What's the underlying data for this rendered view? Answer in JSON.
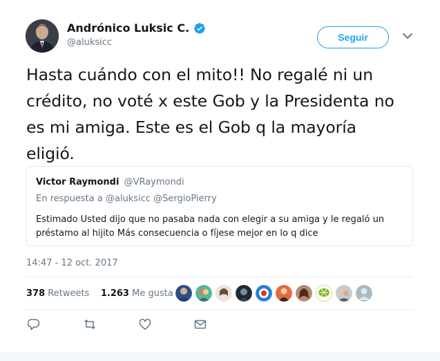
{
  "author": {
    "name": "Andrónico Luksic C.",
    "handle": "@aluksicc",
    "verified": true
  },
  "follow_label": "Seguir",
  "tweet_lines": [
    "Hasta cuándo con el mito!! No regalé ni un",
    "crédito, no voté x este Gob y la Presidenta no",
    "es mi amiga. Este es el Gob q la mayoría",
    "eligió."
  ],
  "quoted": {
    "name": "Victor Raymondi",
    "handle": "@VRaymondi",
    "reply_prefix": "En respuesta a",
    "reply_handles": "@aluksicc @SergioPierry",
    "text_lines": [
      "Estimado Usted dijo que no pasaba nada con elegir a su amiga y le regaló un",
      "préstamo al hijito Más consecuencia o fíjese mejor en lo q dice"
    ]
  },
  "timestamp": "14:47 - 12 oct. 2017",
  "stats": {
    "retweets_count": "378",
    "retweets_label": "Retweets",
    "likes_count": "1.263",
    "likes_label": "Me gusta"
  },
  "colors": {
    "accent": "#1da1f2",
    "secondary_text": "#657786",
    "border": "#e1e8ed"
  },
  "icons": [
    "verified-badge-icon",
    "chevron-down-icon",
    "reply-icon",
    "retweet-icon",
    "like-icon",
    "message-icon"
  ]
}
